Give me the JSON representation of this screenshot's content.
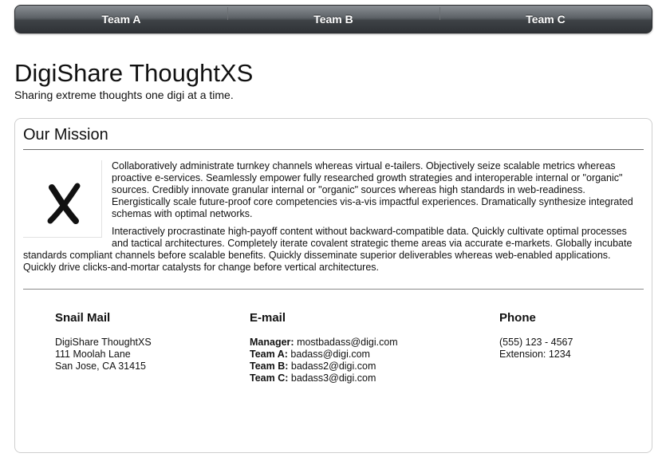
{
  "nav": {
    "items": [
      {
        "label": "Team A"
      },
      {
        "label": "Team B"
      },
      {
        "label": "Team C"
      }
    ]
  },
  "header": {
    "title": "DigiShare ThoughtXS",
    "tagline": "Sharing extreme thoughts one digi at a time."
  },
  "mission": {
    "heading": "Our Mission",
    "logo_icon": "x-mark-icon",
    "paragraphs": [
      "Collaboratively administrate turnkey channels whereas virtual e-tailers. Objectively seize scalable metrics whereas proactive e-services. Seamlessly empower fully researched growth strategies and interoperable internal or \"organic\" sources. Credibly innovate granular internal or \"organic\" sources whereas high standards in web-readiness. Energistically scale future-proof core competencies vis-a-vis impactful experiences. Dramatically synthesize integrated schemas with optimal networks.",
      "Interactively procrastinate high-payoff content without backward-compatible data. Quickly cultivate optimal processes and tactical architectures. Completely iterate covalent strategic theme areas via accurate e-markets. Globally incubate standards compliant channels before scalable benefits. Quickly disseminate superior deliverables whereas web-enabled applications. Quickly drive clicks-and-mortar catalysts for change before vertical architectures."
    ]
  },
  "contact": {
    "snail_mail": {
      "heading": "Snail Mail",
      "lines": [
        "DigiShare ThoughtXS",
        "111 Moolah Lane",
        "San Jose, CA 31415"
      ]
    },
    "email": {
      "heading": "E-mail",
      "entries": [
        {
          "label": "Manager:",
          "value": "mostbadass@digi.com"
        },
        {
          "label": "Team A:",
          "value": "badass@digi.com"
        },
        {
          "label": "Team B:",
          "value": "badass2@digi.com"
        },
        {
          "label": "Team C:",
          "value": "badass3@digi.com"
        }
      ]
    },
    "phone": {
      "heading": "Phone",
      "lines": [
        "(555) 123 - 4567",
        "Extension: 1234"
      ]
    }
  }
}
